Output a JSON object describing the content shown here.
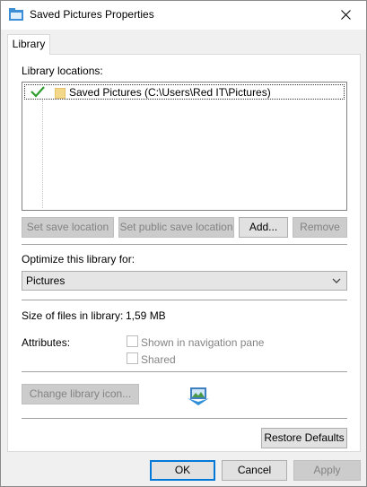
{
  "window": {
    "title": "Saved Pictures Properties",
    "icon": "library-folder-icon",
    "close_icon": "close-icon"
  },
  "tabs": [
    {
      "label": "Library"
    }
  ],
  "locations": {
    "heading": "Library locations:",
    "items": [
      {
        "label": "Saved Pictures (C:\\Users\\Red IT\\Pictures)",
        "checked": true
      }
    ]
  },
  "location_buttons": {
    "set_save": "Set save location",
    "set_public_save": "Set public save location",
    "add": "Add...",
    "remove": "Remove"
  },
  "optimize": {
    "label": "Optimize this library for:",
    "value": "Pictures"
  },
  "size": {
    "label": "Size of files in library:",
    "value": "1,59 MB"
  },
  "attributes": {
    "label": "Attributes:",
    "shown_in_nav": "Shown in navigation pane",
    "shared": "Shared"
  },
  "change_icon": "Change library icon...",
  "restore_defaults": "Restore Defaults",
  "dialog_buttons": {
    "ok": "OK",
    "cancel": "Cancel",
    "apply": "Apply"
  },
  "colors": {
    "accent": "#0078d7",
    "check_green": "#2e9e2e",
    "folder": "#f4d88a"
  }
}
